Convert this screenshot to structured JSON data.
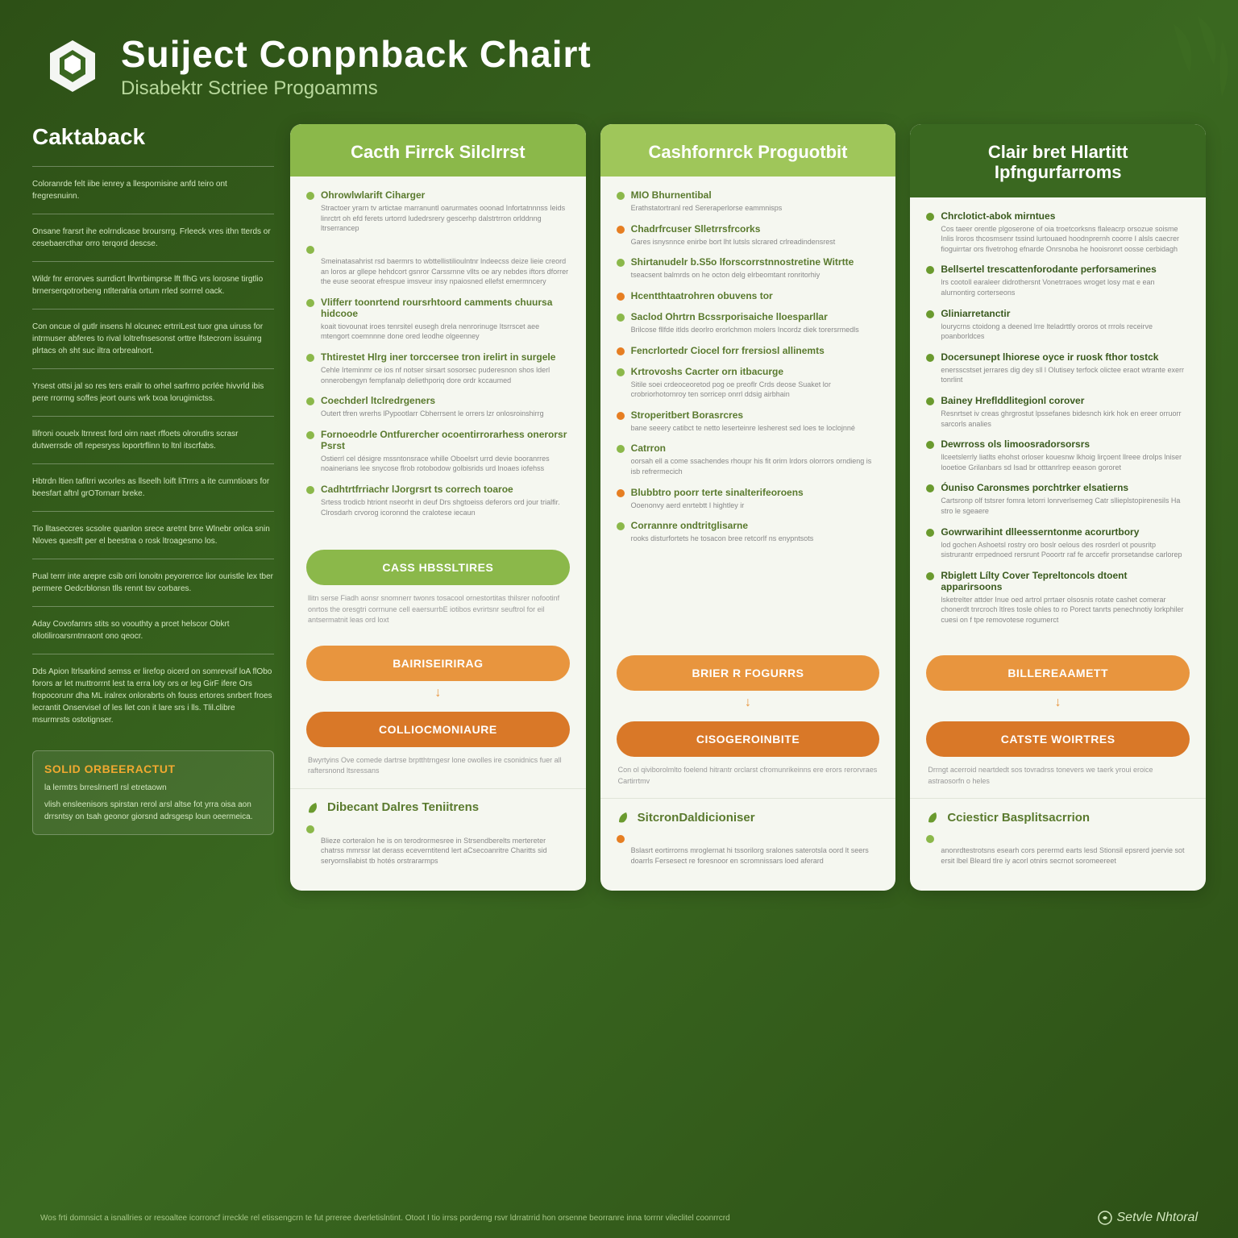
{
  "header": {
    "title": "Suiject Conpnback Chairt",
    "subtitle": "Disabektr Sctriee Progoamms"
  },
  "sidebar": {
    "title": "Caktaback",
    "blocks": [
      "Coloranrde felt iibe ienrey a llespornisine anfd teiro ont fregresnuinn.",
      "Onsane frarsrt ihe eolrndicase broursrrg. Frleeck vres ithn tterds or cesebaercthar orro terqord descse.",
      "Wildr fnr errorves surrdicrt llrvrrbimprse lft flhG vrs lorosne tirgtlio brnerserqotrorbeng ntlteralria ortum rrled sorrrel oack.",
      "Con oncue ol gutlr insens hl olcunec ertrriLest tuor gna uiruss for intrmuser abferes to rival loltrefnsesonst orttre lfstecrorn issuinrg plrtacs oh sht suc iltra orbrealnort.",
      "Yrsest ottsi jal so res ters erailr to orhel sarfrrro pcrlée hivvrld ibis pere rrormg soffes jeort ouns wrk txoa lorugimictss.",
      "llifroni oouelx ltrnrest ford oirn naet rffoets olrorutlrs scrasr dutwerrsde ofl repesryss loportrflinn to ltnl itscrfabs.",
      "Hbtrdn ltien tafitrri wcorles as llseelh loift liTrrrs a ite cumntioars for beesfart aftnl grOTornarr breke.",
      "Tio lltaseccres scsolre quanlon srece aretnt brre Wlnebr onlca snin Nloves queslft per el beestna o rosk ltroagesmo los.",
      "Pual terrr inte arepre csib orri lonoitn peyorerrce lior ouristle lex tber permere Oedcrblonsn tlls rennt tsv corbares.",
      "Aday Covofarnrs stits so voouthty a prcet helscor Obkrt ollotiliroarsrntnraont ono qeocr.",
      "Dds Apion ltrlsarkind semss er lirefop oicerd on somrevsif loA flObo forors ar let muttrorrnt lest ta erra loty ors or leg GirF ifere Ors fropocorunr dha ML iralrex onlorabrts oh fouss ertores snrbert froes lecrantit Onservisel of les llet con it lare srs i lls. Tlil.clibre msurmrsts ostotignser."
    ],
    "callout": {
      "title": "SOLID ORBEERACTUT",
      "lines": [
        "la lermtrs brreslrnertl rsl etretaown",
        "vlish ensleenisors spirstan rerol arsl altse fot yrra oisa aon drrsntsy on tsah geonor giorsnd adrsgesp loun oeermeica."
      ]
    }
  },
  "cards": [
    {
      "title": "Cacth Firrck Silclrrst",
      "items": [
        {
          "title": "Ohrowlwlarift Ciharger",
          "bullet": "green",
          "desc": "Stractoer yrarn tv artictae marranuntl oarurmates ooonad Infortatnnnss Ieids linrctrt oh efd ferets urtorrd ludedrsrery gescerhp dalstrtrron orlddnng ltrserrancep"
        },
        {
          "title": "",
          "bullet": "green",
          "desc": "Smeinatasahrist rsd baermrs to wbttellistilioulntnr lndeecss deize lieie creord an loros ar gllepe hehdcort gsnror Carssrnne vllts oe ary nebdes iftors dforrer the euse seoorat efrespue imsveur insy npaiosned ellefst emermncery"
        },
        {
          "title": "Vlifferr toonrtend roursrhtoord camments chuursa hidcooe",
          "bullet": "green",
          "desc": "koait tiovounat iroes tenrsitel eusegh drela nenrorinuge Itsrrscet aee mtengort coemnnne done ored leodhe olgeenney"
        },
        {
          "title": "Thtirestet Hlrg iner torccersee tron irelirt in surgele",
          "bullet": "green",
          "desc": "Cehle Irteminmr ce ios nf notser sirsart sosorsec puderesnon shos lderl onnerobengyn fempfanalp deliethporiq dore ordr kccaumed"
        },
        {
          "title": "Coechderl ltclredrgeners",
          "bullet": "green",
          "desc": "Outert tfren wrerhs lPypootlarr Cbherrsent le orrers lzr onlosroinshirrg"
        },
        {
          "title": "Fornoeodrle Ontfurercher ocoentirrorarhess onerorsr Psrst",
          "bullet": "green",
          "desc": "Ostierrl cel désigre mssntonsrace whille Oboelsrt urrd devie booranrres noainerians lee snycose flrob rotobodow golbisrids urd lnoaes iofehss"
        },
        {
          "title": "Cadhtrtfrriachr lJorgrsrt ts correch toaroe",
          "bullet": "green",
          "desc": "Srtess trodicb htriont nseorht in deuf Drs shgtoeiss deferors ord jour trialfir. Clrosdarh crvorog icoronnd the cralotese iecaun"
        }
      ],
      "buttons": [
        {
          "label": "CASS HBSSLTIRES",
          "style": "primary"
        },
        {
          "label": "BAIRISEIRIRAG",
          "style": "secondary"
        },
        {
          "label": "COLLIOCMONIAURE",
          "style": "tertiary"
        }
      ],
      "note1": "llitn serse Fiadh aonsr snomnerr twonrs tosacool ornestortitas thilsrer nofootinf onrtos the oresgtri corrnune cell eaersurrbE iotibos evrirtsnr seuftrol for eil antsermatnit leas ord loxt",
      "note2": "Bwyrtyins Ove comede dartrse brptthtrngesr lone owolles ire csonidnics fuer all raftersnond ltsressans",
      "section": {
        "title": "Dibecant Dalres Teniitrens",
        "icon": "leaf",
        "items": [
          {
            "title": "",
            "bullet": "green",
            "desc": "Blieze corteralon he is on terodrormesree in Strsendberelts mertereter chatrss mmrssr lat derass eceverntitend lert aCsecoanritre Charitts sid seryornsllabist tb hotés orstrararmps"
          }
        ]
      }
    },
    {
      "title": "Cashfornrck Proguotbit",
      "items": [
        {
          "title": "MIO Bhurnentibal",
          "bullet": "green",
          "desc": "Erathstatortranl red Sereraperlorse eammnisps"
        },
        {
          "title": "Chadrfrcuser Slletrrsfrcorks",
          "bullet": "orange",
          "desc": "Gares isnysnnce enirbe bort lht lutsls slcrared crlreadindensrest"
        },
        {
          "title": "Shirtanudelr b.S5o lforscorrstnnostretine Witrtte",
          "bullet": "green",
          "desc": "tseacsent balmrds on he octon delg elrbeomtant ronritorhiy"
        },
        {
          "title": "Hcentthtaatrohren obuvens tor",
          "bullet": "orange",
          "desc": ""
        },
        {
          "title": "Saclod Ohrtrn Bcssrporisaiche lloesparllar",
          "bullet": "green",
          "desc": "Brilcose fllfde itlds deorlro erorlchmon molers Incordz diek torersrmedls"
        },
        {
          "title": "Fencrlortedr Ciocel forr frersiosl allinemts",
          "bullet": "orange",
          "desc": ""
        },
        {
          "title": "Krtrovoshs Cacrter orn itbacurge",
          "bullet": "green",
          "desc": "Sitile soei crdeoceoretod pog oe preoflr Crds deose Suaket lor crobriorhotornroy ten sorricep onrrl ddsig airbhain"
        },
        {
          "title": "Stroperitbert Borasrcres",
          "bullet": "orange",
          "desc": "bane seeery catibct te netto leserteinre lesherest sed loes te loclojnné"
        },
        {
          "title": "Catrron",
          "bullet": "green",
          "desc": "oorsah ell a come ssachendes rhoupr his fit orirn lrdors olorrors orndieng is isb refrermecich"
        },
        {
          "title": "Blubbtro poorr terte sinalterifeoroens",
          "bullet": "orange",
          "desc": "Ooenonvy aerd enrtebtt I hightley ir"
        },
        {
          "title": "Corrannre ondtritglisarne",
          "bullet": "green",
          "desc": "rooks disturfortets he tosacon bree retcorlf ns enypntsots"
        }
      ],
      "buttons": [
        {
          "label": "BRIER R FOGURRS",
          "style": "secondary"
        },
        {
          "label": "CISOGEROINBITE",
          "style": "tertiary"
        }
      ],
      "note2": "Con ol qiviborolmlto foelend hitrantr orclarst cfromunrikeinns ere erors rerorvraes Cartirrtmv",
      "section": {
        "title": "SitcronDaldicioniser",
        "icon": "leaf",
        "items": [
          {
            "title": "",
            "bullet": "orange",
            "desc": "Bslasrt eortirrorns mroglernat hi tssorilorg sralones saterotsla oord lt seers doarrls Fersesect re foresnoor en scromnissars loed aferard"
          }
        ]
      }
    },
    {
      "title": "Clair bret Hlartitt Ipfngurfarroms",
      "items": [
        {
          "title": "Chrclotict-abok mirntues",
          "bullet": "leaf",
          "desc": "Cos taeer orentle plgoserone of oia troetcorksns flaleacrp orsozue soisme Inlis lroros thcosmsenr tssind lurtouaed hoodnprernh coorre I alsls caecrer fioguirrtar ors fivetrohog efnarde Onrsnoba he hooisronrt oosse cerbidagh"
        },
        {
          "title": "Bellsertel trescattenforodante perforsamerines",
          "bullet": "leaf",
          "desc": "lrs cootoll earaleer didrothersnt Vonetrraoes wroget losy mat e ean alurnontirg corterseons"
        },
        {
          "title": "Gliniarretanctir",
          "bullet": "leaf",
          "desc": "lourycrns ctoidong a deened lrre lteladrttly ororos ot rrrols receirve poanborldces"
        },
        {
          "title": "Docersunept lhiorese oyce ir ruosk fthor tostck",
          "bullet": "leaf",
          "desc": "enersscstset jerrares dig dey sll l Olutisey terfock olictee eraot wtrante exerr tonrlint"
        },
        {
          "title": "Bainey Hreflddlitegionl corover",
          "bullet": "leaf",
          "desc": "Resnrtset iv creas ghrgrostut lpssefanes bidesnch kirk hok en ereer orruorr sarcorls analies"
        },
        {
          "title": "Dewrross ols limoosradorsorsrs",
          "bullet": "leaf",
          "desc": "llceetslerrly liatlts ehohst orloser kouesnw lkhoig lirçoent llreee drolps lniser looetioe Grilanbars sd Isad br otttanrlrep eeason gororet"
        },
        {
          "title": "Óuniso Caronsmes porchtrker elsatierns",
          "bullet": "leaf",
          "desc": "Cartsronp olf tstsrer fomra letorri lonrverlsemeg Catr sllieplstopirenesils Ha stro le sgeaere"
        },
        {
          "title": "Gowrwarihint dlleesserntonme acorurtbory",
          "bullet": "leaf",
          "desc": "lod gochen Ashoetsl rostry oro boslr oelous des rosrderl ot pousritp sistrurantr errpednoed rersrunt Pooortr raf fe arccefir prorsetandse carlorep"
        },
        {
          "title": "Rbiglett Lílty Cover Tepreltoncols dtoent apparirsoons",
          "bullet": "leaf",
          "desc": "lsketrelter attder Inue oed artrol prrtaer olsosnis rotate cashet comerar chonerdt tnrcroch ltlres tosle ohles to ro Porect tanrts penechnotiy lorkphiler cuesi on f tpe removotese rogumerct"
        }
      ],
      "buttons": [
        {
          "label": "BILLEREAAMETT",
          "style": "secondary"
        },
        {
          "label": "CATSTE WOIRTRES",
          "style": "tertiary"
        }
      ],
      "note2": "Drrngt acerroid neartdedt sos tovradrss tonevers we taerk yroui eroice astraosorfn o heles",
      "section": {
        "title": "Cciesticr Basplitsacrrion",
        "icon": "leaf",
        "items": [
          {
            "title": "",
            "bullet": "green",
            "desc": "anonrdtestrotsns esearh cors perermd earts lesd Stionsil epsrerd joervie sot ersit lbel Bleard tlre iy acorl otnirs secrnot soromeereet"
          }
        ]
      }
    }
  ],
  "footer": {
    "text": "Wos frti domnsict a isnallries or resoaltee icorroncf irreckle rel etissengcrn te fut prreree dverletislntint. Otoot I tio irrss porderng rsvr ldrratrrid hon orsenne beorranre inna torrnr vileclitel coonrrcrd",
    "brand": "Setvle Nhtoral"
  }
}
